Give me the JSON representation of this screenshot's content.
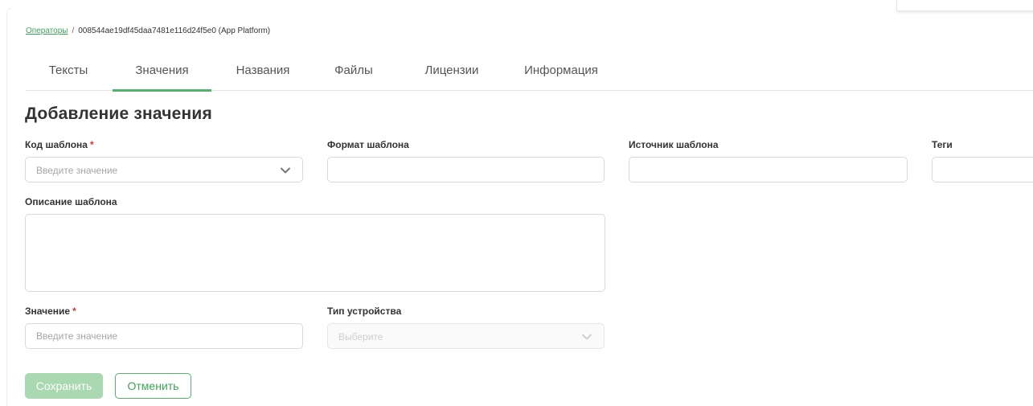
{
  "breadcrumb": {
    "parent": "Операторы",
    "separator": "/",
    "current": "008544ae19df45daa7481e116d24f5e0 (App Platform)"
  },
  "tabs": [
    {
      "label": "Тексты",
      "active": false
    },
    {
      "label": "Значения",
      "active": true
    },
    {
      "label": "Названия",
      "active": false
    },
    {
      "label": "Файлы",
      "active": false
    },
    {
      "label": "Лицензии",
      "active": false
    },
    {
      "label": "Информация",
      "active": false
    }
  ],
  "page_title": "Добавление значения",
  "form": {
    "template_code": {
      "label": "Код шаблона",
      "required_mark": "*",
      "placeholder": "Введите значение",
      "icon": "chevron-down-icon"
    },
    "template_format": {
      "label": "Формат шаблона",
      "value": ""
    },
    "template_source": {
      "label": "Источник шаблона",
      "value": ""
    },
    "tags": {
      "label": "Теги",
      "value": ""
    },
    "template_description": {
      "label": "Описание шаблона",
      "value": ""
    },
    "value": {
      "label": "Значение",
      "required_mark": "*",
      "placeholder": "Введите значение"
    },
    "device_type": {
      "label": "Тип устройства",
      "placeholder": "Выберите",
      "disabled": true,
      "icon": "chevron-down-icon"
    }
  },
  "buttons": {
    "save": "Сохранить",
    "cancel": "Отменить"
  },
  "colors": {
    "accent": "#54b26a",
    "link": "#3aa655",
    "save_disabled": "#a9d8b1",
    "required": "#e03131"
  }
}
